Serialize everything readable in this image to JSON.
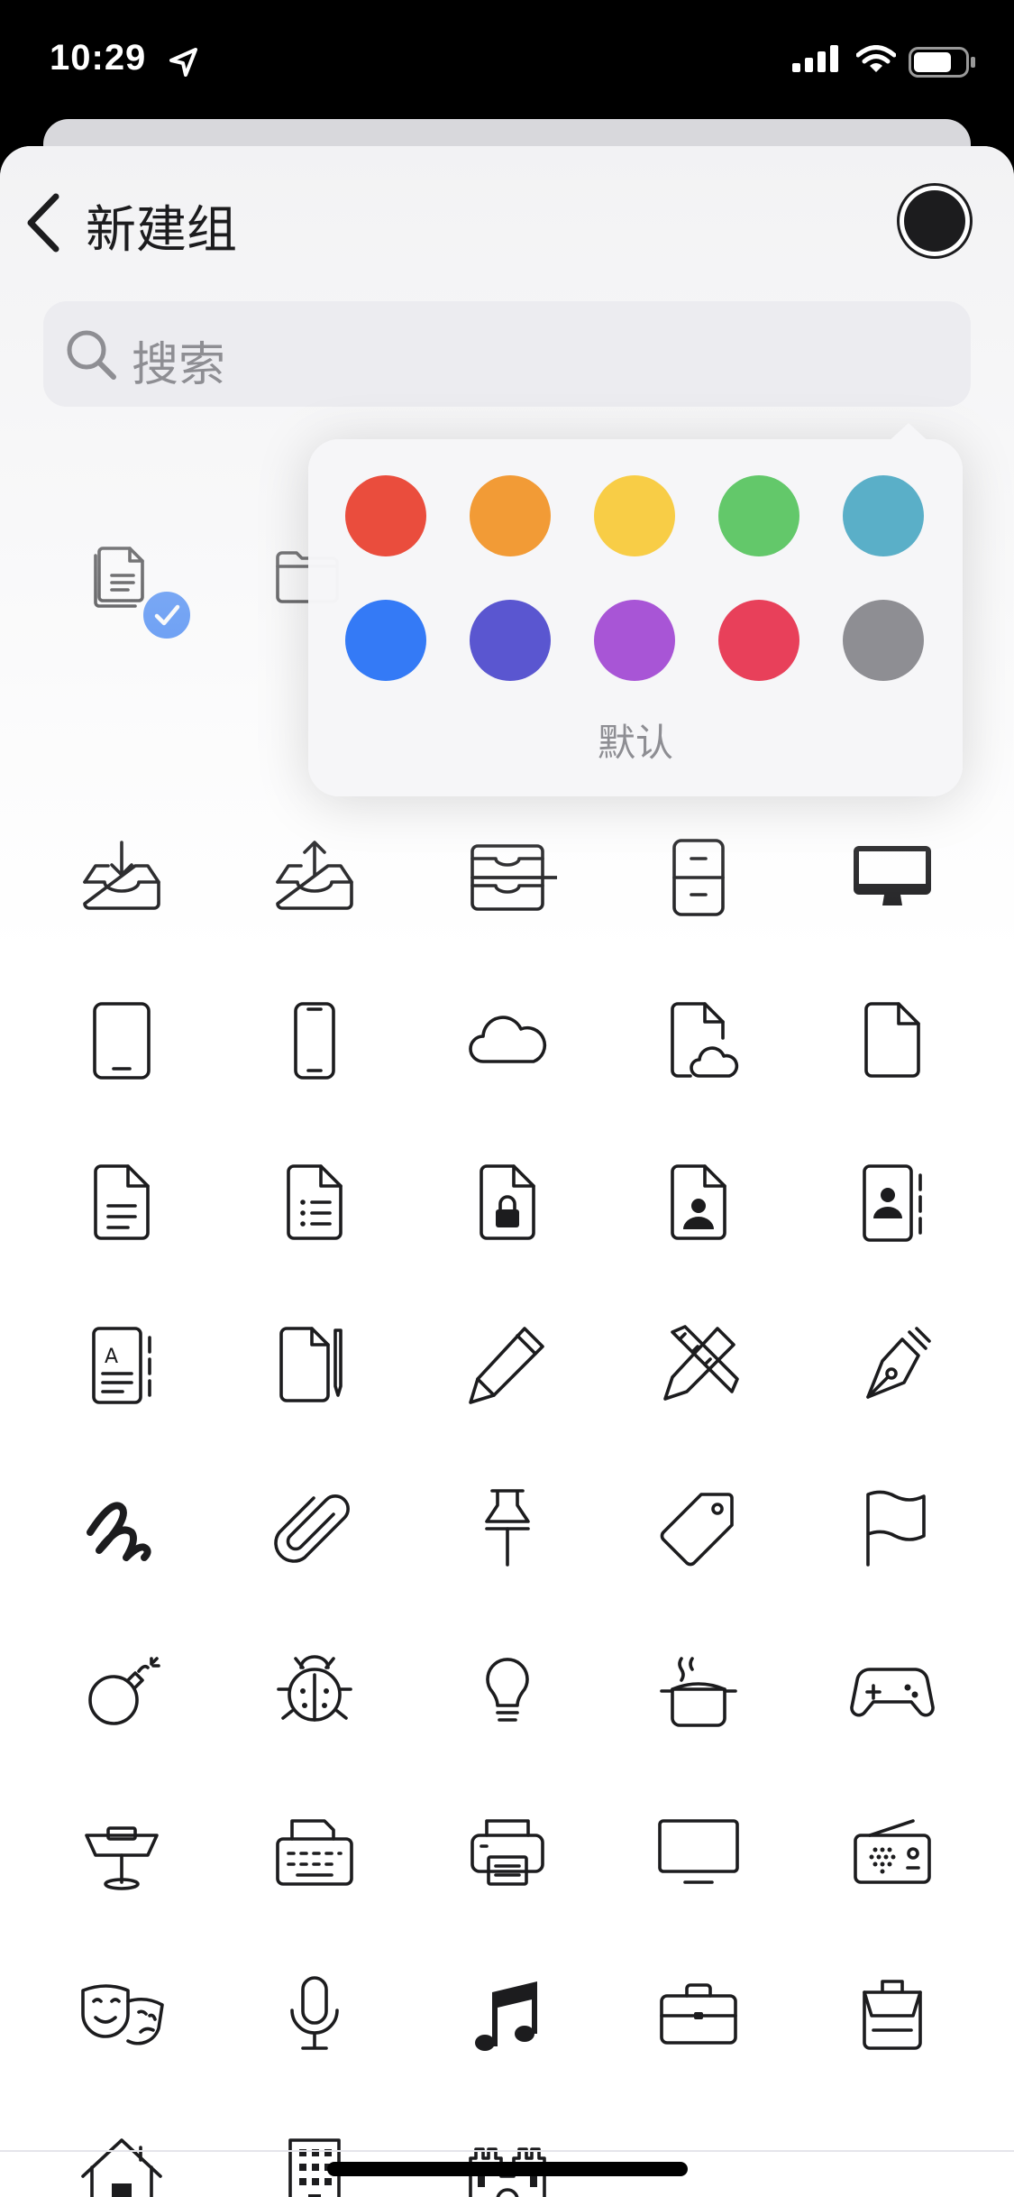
{
  "status_bar": {
    "time": "10:29"
  },
  "nav": {
    "title": "新建组"
  },
  "search": {
    "placeholder": "搜索"
  },
  "color_picker": {
    "selected": "#1c1c1e",
    "default_label": "默认",
    "colors": [
      "#ea4d3d",
      "#f29b36",
      "#f8cd46",
      "#63c86a",
      "#5aafc8",
      "#347af6",
      "#5a56d0",
      "#a855d6",
      "#e8405a",
      "#8e8e93"
    ]
  },
  "icons": [
    "docs-icon",
    "folder-icon",
    "tray-icon",
    "trays-icon",
    "archivebox-icon",
    "tray-download-icon",
    "tray-upload-icon",
    "archive-drawers-icon",
    "file-cabinet-icon",
    "desktop-icon",
    "tablet-icon",
    "phone-icon",
    "cloud-icon",
    "doc-cloud-icon",
    "doc-icon",
    "doc-text-icon",
    "doc-list-icon",
    "doc-lock-icon",
    "doc-person-icon",
    "contact-book-icon",
    "text-book-icon",
    "doc-pencil-icon",
    "pencil-icon",
    "pencil-ruler-icon",
    "fountain-pen-icon",
    "scribble-icon",
    "paperclip-icon",
    "pin-icon",
    "tag-icon",
    "flag-icon",
    "bomb-icon",
    "ladybug-icon",
    "lightbulb-icon",
    "cooking-pot-icon",
    "gamecontroller-icon",
    "keynote-lectern-icon",
    "typewriter-icon",
    "printer-icon",
    "monitor-icon",
    "radio-icon",
    "theater-masks-icon",
    "microphone-icon",
    "music-note-icon",
    "briefcase-icon",
    "backpack-icon",
    "house-icon",
    "building-icon",
    "castle-icon"
  ]
}
